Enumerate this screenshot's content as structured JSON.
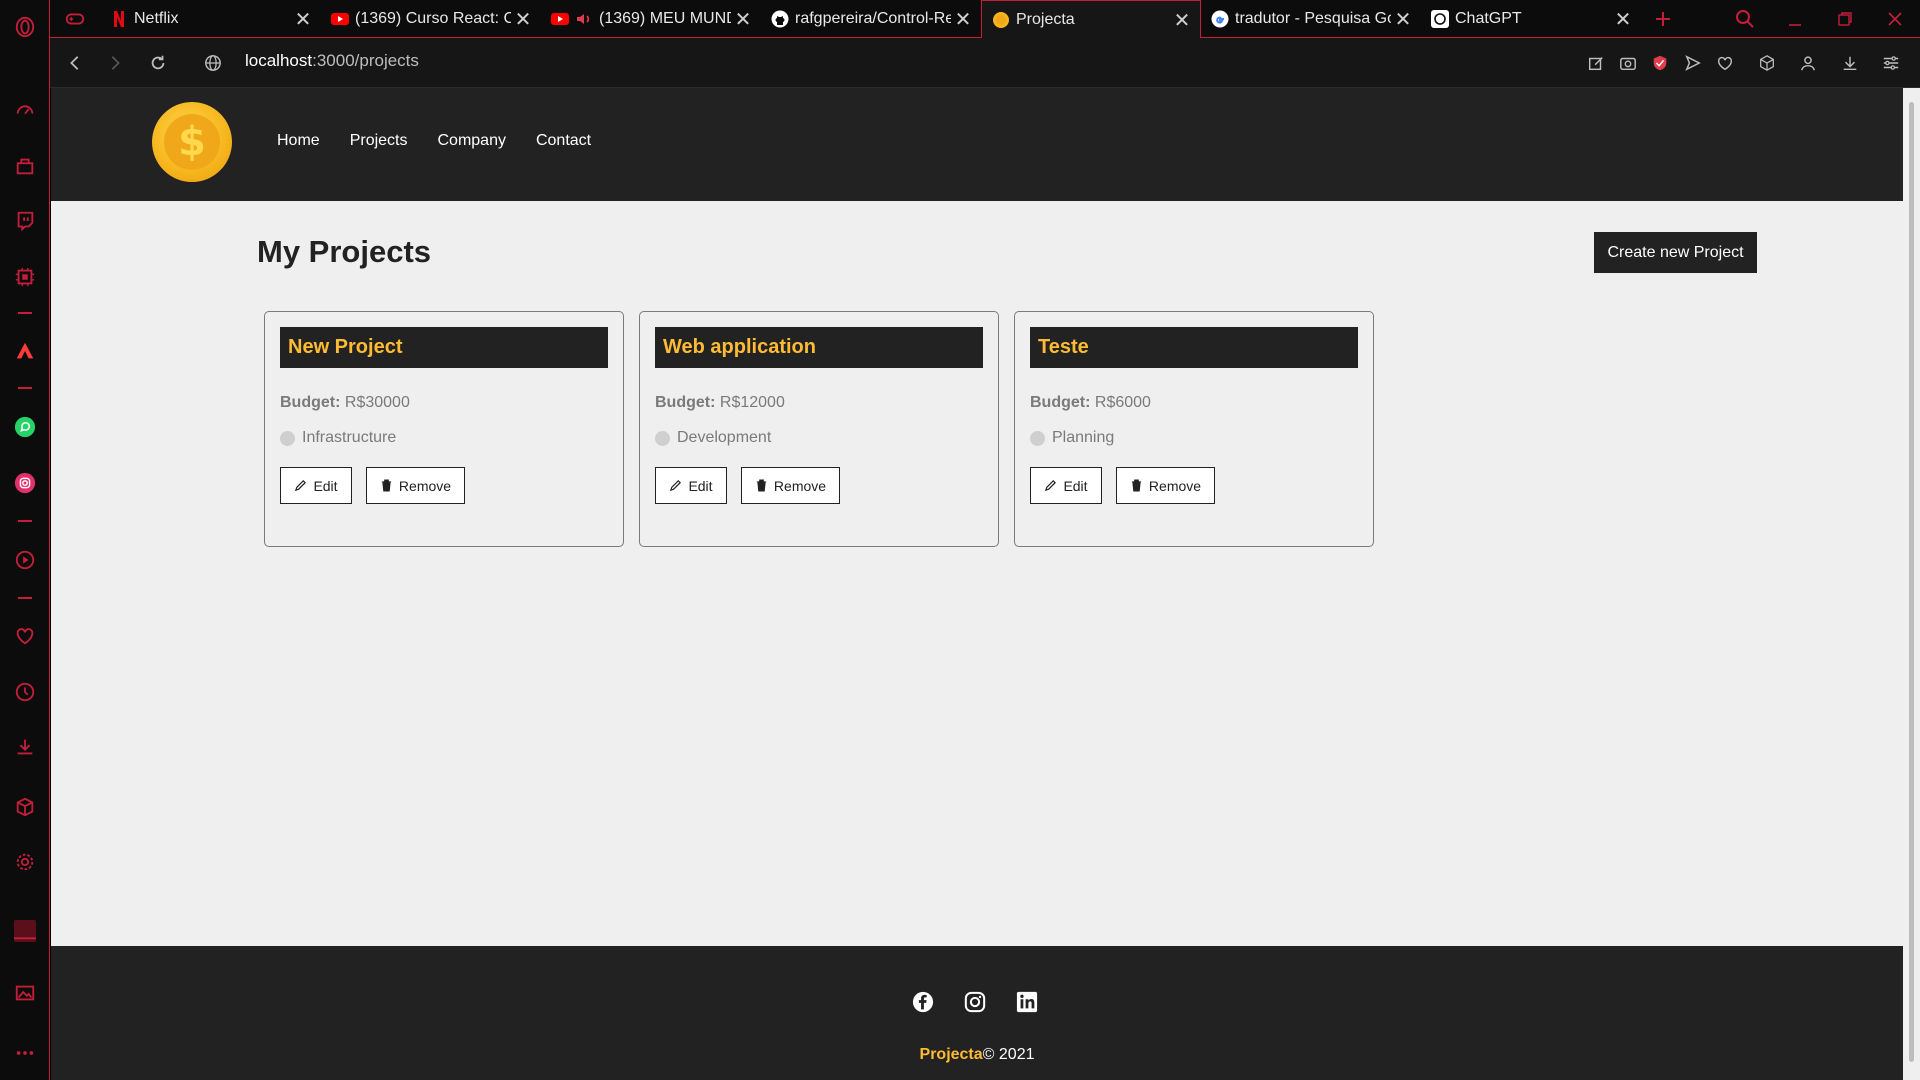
{
  "browser": {
    "tabs": [
      {
        "title": "Netflix",
        "favicon": "netflix-icon",
        "active": false
      },
      {
        "title": "(1369) Curso React: Co",
        "favicon": "youtube-icon",
        "active": false
      },
      {
        "title": "(1369) MEU MUND",
        "favicon": "youtube-icon",
        "active": false
      },
      {
        "title": "rafgpereira/Control-Re",
        "favicon": "github-icon",
        "active": false
      },
      {
        "title": "Projecta",
        "favicon": "coin-icon",
        "active": true
      },
      {
        "title": "tradutor - Pesquisa Go",
        "favicon": "google-icon",
        "active": false
      },
      {
        "title": "ChatGPT",
        "favicon": "chatgpt-icon",
        "active": false
      }
    ],
    "url_host": "localhost",
    "url_path": ":3000/projects",
    "accent_color": "#c41e3a"
  },
  "site": {
    "nav": [
      "Home",
      "Projects",
      "Company",
      "Contact"
    ],
    "page_title": "My Projects",
    "create_button": "Create new Project",
    "budget_label": "Budget:",
    "edit_label": "Edit",
    "remove_label": "Remove",
    "projects": [
      {
        "name": "New Project",
        "budget": "R$30000",
        "category": "Infrastructure"
      },
      {
        "name": "Web application",
        "budget": "R$12000",
        "category": "Development"
      },
      {
        "name": "Teste",
        "budget": "R$6000",
        "category": "Planning"
      }
    ],
    "footer": {
      "brand": "Projecta",
      "copyright": "© 2021",
      "socials": [
        "facebook-icon",
        "instagram-icon",
        "linkedin-icon"
      ]
    },
    "colors": {
      "dark": "#222222",
      "accent": "#ffbb33",
      "background": "#efefef"
    }
  }
}
